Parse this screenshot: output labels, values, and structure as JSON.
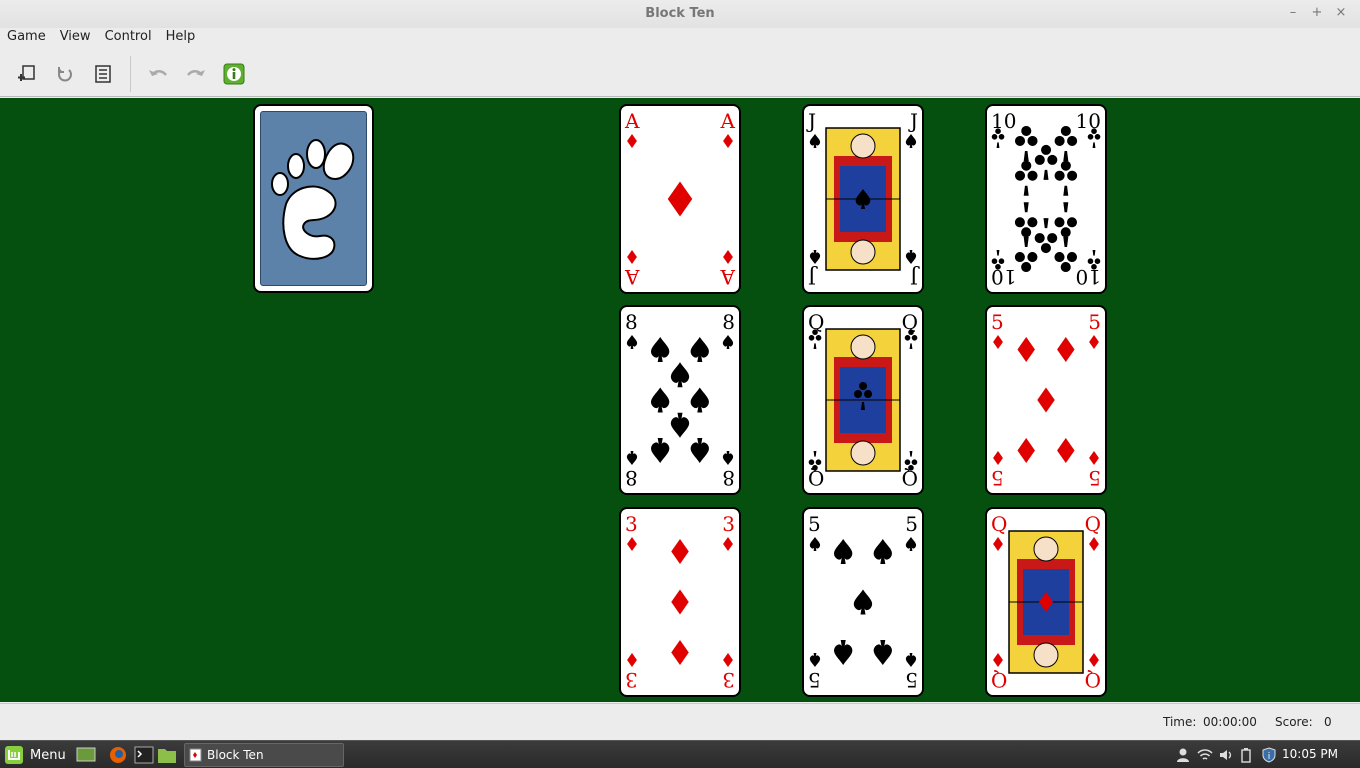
{
  "window": {
    "title": "Block Ten",
    "minimize": "–",
    "maximize": "+",
    "close": "×"
  },
  "menu": [
    "Game",
    "View",
    "Control",
    "Help"
  ],
  "toolbar": {
    "items": [
      {
        "name": "new-game-icon"
      },
      {
        "name": "restart-icon"
      },
      {
        "name": "statistics-icon"
      },
      {
        "name": "undo-icon"
      },
      {
        "name": "redo-icon"
      },
      {
        "name": "hint-icon"
      }
    ]
  },
  "stock": {
    "face": "down",
    "back": "gnome-foot-icon"
  },
  "cards": [
    {
      "rank": "A",
      "suit": "diamond",
      "color": "#e00000"
    },
    {
      "rank": "J",
      "suit": "spade",
      "color": "#000000"
    },
    {
      "rank": "10",
      "suit": "club",
      "color": "#000000"
    },
    {
      "rank": "8",
      "suit": "spade",
      "color": "#000000"
    },
    {
      "rank": "Q",
      "suit": "club",
      "color": "#000000"
    },
    {
      "rank": "5",
      "suit": "diamond",
      "color": "#e00000"
    },
    {
      "rank": "3",
      "suit": "diamond",
      "color": "#e00000"
    },
    {
      "rank": "5",
      "suit": "spade",
      "color": "#000000"
    },
    {
      "rank": "Q",
      "suit": "diamond",
      "color": "#e00000"
    }
  ],
  "status": {
    "time_label": "Time:",
    "time_value": "00:00:00",
    "score_label": "Score:",
    "score_value": "0"
  },
  "taskbar": {
    "menu_label": "Menu",
    "window_label": "Block Ten",
    "clock": "10:05 PM"
  },
  "colors": {
    "felt": "#06500f",
    "card_back": "#5d82aa",
    "red_suit": "#e00000"
  }
}
